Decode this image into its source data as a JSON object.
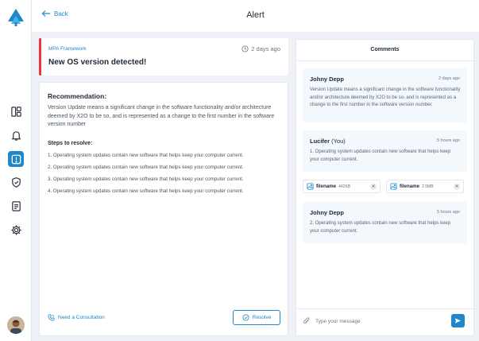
{
  "header": {
    "back_label": "Back",
    "title": "Alert"
  },
  "sidebar": {
    "items": [
      {
        "icon": "dashboard-icon"
      },
      {
        "icon": "bell-icon"
      },
      {
        "icon": "alert-icon",
        "active": true
      },
      {
        "icon": "shield-icon"
      },
      {
        "icon": "document-icon"
      },
      {
        "icon": "gear-icon"
      }
    ]
  },
  "alert": {
    "source": "MPA Framework",
    "title": "New OS version detected!",
    "time": "2 days ago"
  },
  "recommendation": {
    "heading": "Recommendation:",
    "body": "Version Update means a significant change in the software functionality and/or architecture deemed by X2O to be so, and is represented as a change to the first number in the software version number",
    "steps_heading": "Steps to resolve:",
    "steps": [
      "1. Operating system updates contain new software that helps keep your computer current.",
      "2. Operating system updates contain new software that helps keep your computer current.",
      "3. Operating system updates contain new software that helps keep your computer current.",
      "4. Operating system updates contain new software that helps keep your computer current."
    ],
    "consult_label": "Need a Consultation",
    "resolve_label": "Resolve"
  },
  "comments": {
    "title": "Comments",
    "items": [
      {
        "author": "Johny Depp",
        "time": "2 days ago",
        "text": "Version Update means a significant change in the software functionality and/or architecture deemed by X2O to be so, and is represented as a change to the first number in the software version number."
      },
      {
        "author": "Lucifer",
        "author_suffix": "(You)",
        "time": "5 hours ago",
        "text": "1. Operating system updates contain new software that helps keep your computer current."
      },
      {
        "author": "Johny Depp",
        "time": "5 hours ago",
        "text": "2. Operating system updates contain new software that helps keep your computer current."
      }
    ],
    "attachments": [
      {
        "name": "filename",
        "size": "442KB"
      },
      {
        "name": "filename",
        "size": "2.5MB"
      }
    ],
    "input_placeholder": "Type your message"
  },
  "colors": {
    "accent": "#1e88c9",
    "alert": "#e53935",
    "comment_bg": "#f3f8fc"
  }
}
